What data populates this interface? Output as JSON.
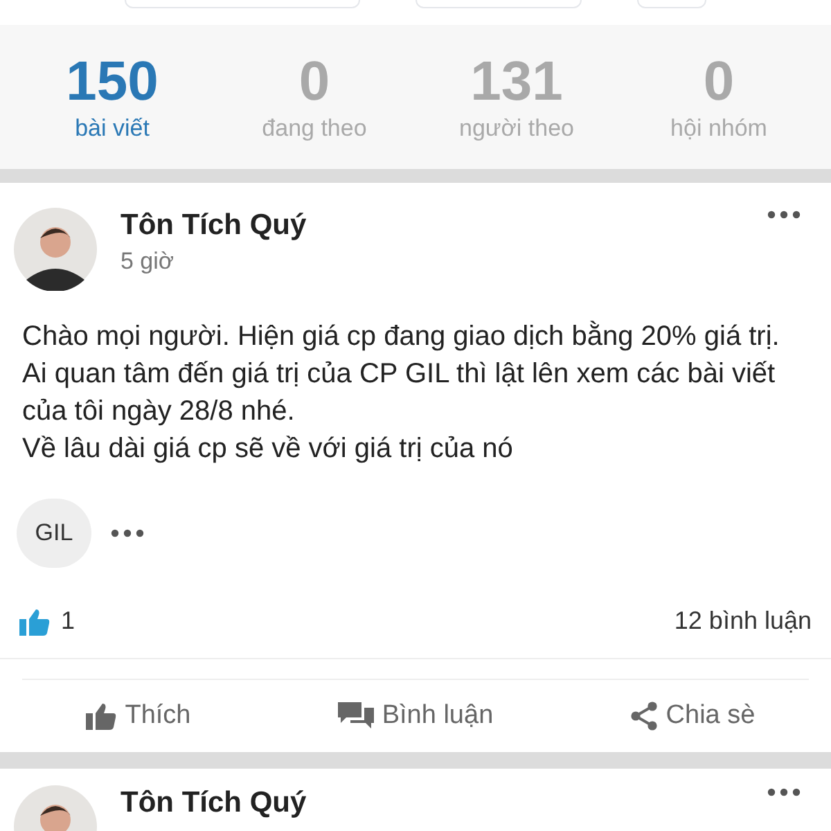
{
  "stats": [
    {
      "value": "150",
      "label": "bài viết",
      "selected": true
    },
    {
      "value": "0",
      "label": "đang theo",
      "selected": false
    },
    {
      "value": "131",
      "label": "người theo",
      "selected": false
    },
    {
      "value": "0",
      "label": "hội nhóm",
      "selected": false
    }
  ],
  "posts": [
    {
      "author": "Tôn Tích Quý",
      "time": "5 giờ",
      "lines": [
        "Chào mọi người. Hiện giá cp đang giao dịch bằng 20% giá trị. Ai quan tâm đến giá trị của CP GIL thì lật lên xem các bài viết của tôi ngày 28/8 nhé.",
        "Về lâu dài giá cp sẽ về với giá trị của nó"
      ],
      "tag": "GIL",
      "likes": "1",
      "comments": "12 bình luận",
      "actions": [
        {
          "kind": "like",
          "label": "Thích"
        },
        {
          "kind": "comment",
          "label": "Bình luận"
        },
        {
          "kind": "share",
          "label": "Chia sè"
        }
      ]
    },
    {
      "author": "Tôn Tích Quý"
    }
  ]
}
